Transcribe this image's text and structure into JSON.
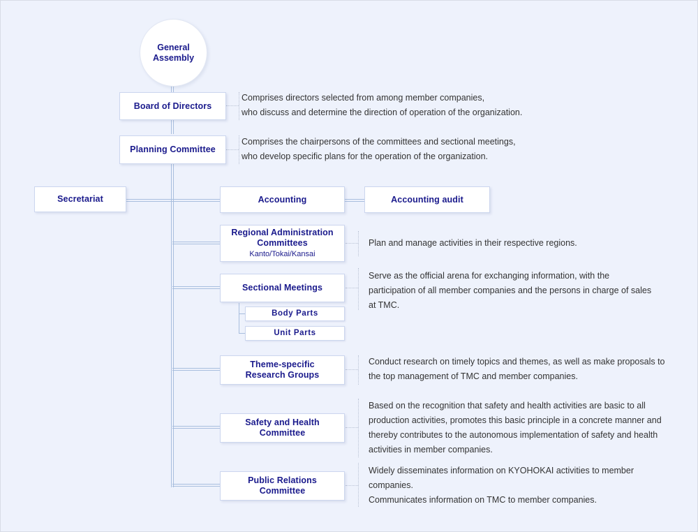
{
  "chart": {
    "type": "org-chart",
    "root": {
      "name": "general-assembly",
      "label": "General Assembly",
      "shape": "circle"
    },
    "nodes": [
      {
        "name": "board-of-directors",
        "label": "Board of Directors",
        "description": [
          "Comprises directors selected from among member companies,",
          "who discuss and determine the direction of operation of the organization."
        ]
      },
      {
        "name": "planning-committee",
        "label": "Planning Committee",
        "description": [
          "Comprises the chairpersons of the committees and sectional meetings,",
          "who develop specific plans for the operation of the organization."
        ]
      },
      {
        "name": "secretariat",
        "label": "Secretariat",
        "description": []
      },
      {
        "name": "accounting",
        "label": "Accounting",
        "description": []
      },
      {
        "name": "accounting-audit",
        "label": "Accounting audit",
        "description": []
      },
      {
        "name": "regional-administration-committees",
        "label": "Regional Administration Committees",
        "sublabel": "Kanto/Tokai/Kansai",
        "description": [
          "Plan and manage activities in their respective regions."
        ]
      },
      {
        "name": "sectional-meetings",
        "label": "Sectional Meetings",
        "description": [
          "Serve as the official arena for exchanging information, with the participation of all member companies and the persons in charge of sales at TMC."
        ],
        "children": [
          {
            "name": "body-parts",
            "label": "Body Parts"
          },
          {
            "name": "unit-parts",
            "label": "Unit Parts"
          }
        ]
      },
      {
        "name": "theme-specific-research-groups",
        "label_line1": "Theme-specific",
        "label_line2": "Research Groups",
        "description": [
          "Conduct research on timely topics and themes, as well as make proposals to the top management of TMC and member companies."
        ]
      },
      {
        "name": "safety-and-health-committee",
        "label_line1": "Safety and Health",
        "label_line2": "Committee",
        "description": [
          "Based on the recognition that safety and health activities are basic to all production activities, promotes this basic principle in a concrete manner and thereby contributes to the autonomous implementation of safety and health activities in member companies."
        ]
      },
      {
        "name": "public-relations-committee",
        "label_line1": "Public Relations",
        "label_line2": "Committee",
        "description": [
          "Widely disseminates information on KYOHOKAI activities to member companies.",
          "Communicates information on TMC to member companies."
        ]
      }
    ],
    "colors": {
      "background": "#eef2fc",
      "node_fill": "#ffffff",
      "node_border": "#ccd6ee",
      "node_text": "#1a1a8c",
      "connector": "#a8bede",
      "leader": "#b9c2d4",
      "description_text": "#333333"
    }
  },
  "general_assembly": {
    "label": "General Assembly"
  },
  "board_of_directors": {
    "label": "Board of Directors",
    "desc_line1": "Comprises directors selected from among member companies,",
    "desc_line2": "who discuss and determine the direction of operation of the organization."
  },
  "planning_committee": {
    "label": "Planning Committee",
    "desc_line1": "Comprises the chairpersons of the committees and sectional meetings,",
    "desc_line2": "who develop specific plans for the operation of the organization."
  },
  "secretariat": {
    "label": "Secretariat"
  },
  "accounting": {
    "label": "Accounting"
  },
  "accounting_audit": {
    "label": "Accounting audit"
  },
  "regional_administration": {
    "label_line1": "Regional Administration",
    "label_line2": "Committees",
    "sublabel": "Kanto/Tokai/Kansai",
    "desc_line1": "Plan and manage activities in their respective regions."
  },
  "sectional_meetings": {
    "label": "Sectional Meetings",
    "desc_line1": "Serve as the official arena for exchanging information, with the",
    "desc_line2": "participation of all member companies and the persons in charge of sales",
    "desc_line3": "at TMC.",
    "body_parts": "Body Parts",
    "unit_parts": "Unit Parts"
  },
  "theme_specific": {
    "label_line1": "Theme-specific",
    "label_line2": "Research Groups",
    "desc_line1": "Conduct research on timely topics and themes, as well as make proposals to",
    "desc_line2": "the top management of TMC and member companies."
  },
  "safety_health": {
    "label_line1": "Safety and Health",
    "label_line2": "Committee",
    "desc_line1": "Based on the recognition that safety and health activities are basic to all",
    "desc_line2": "production activities, promotes this basic principle in a concrete manner and",
    "desc_line3": "thereby contributes to the autonomous implementation of safety and health",
    "desc_line4": "activities in member companies."
  },
  "public_relations": {
    "label_line1": "Public Relations",
    "label_line2": "Committee",
    "desc_line1": "Widely disseminates information on KYOHOKAI activities to member",
    "desc_line2": "companies.",
    "desc_line3": "Communicates information on TMC to member companies."
  }
}
